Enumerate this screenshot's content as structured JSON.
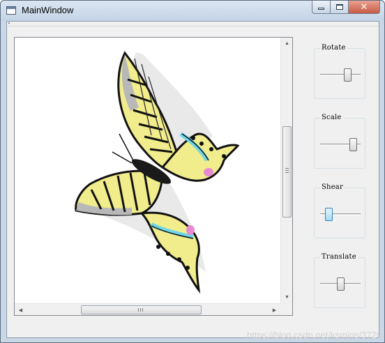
{
  "window": {
    "title": "MainWindow",
    "buttons": {
      "minimize": "minimize",
      "maximize": "maximize",
      "close": "✕"
    }
  },
  "view": {
    "content": "butterfly-image",
    "vertical_scroll_fraction": 0.49,
    "horizontal_scroll_fraction": 0.38
  },
  "controls": [
    {
      "label": "Rotate",
      "value_fraction": 0.72
    },
    {
      "label": "Scale",
      "value_fraction": 0.9
    },
    {
      "label": "Shear",
      "value_fraction": 0.15
    },
    {
      "label": "Translate",
      "value_fraction": 0.5
    }
  ],
  "watermark": "https://blog.csdn.net/ksmins/3729",
  "colors": {
    "titlebar": "#c9d7e6",
    "window_bg": "#f0f0f0",
    "butterfly_yellow": "#f1ec8c",
    "butterfly_black": "#111111",
    "butterfly_cyan": "#6fd6e6",
    "butterfly_pink": "#e88ad0"
  }
}
